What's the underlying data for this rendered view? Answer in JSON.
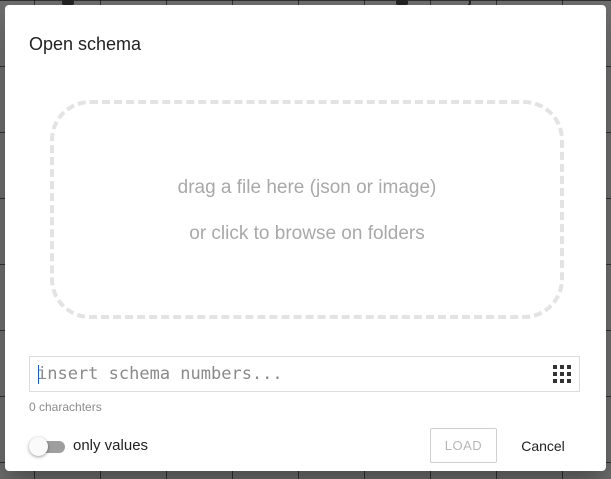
{
  "dialog": {
    "title": "Open schema"
  },
  "dropzone": {
    "line1": "drag a file here (json or image)",
    "line2": "or click to browse on folders"
  },
  "schema_input": {
    "value": "",
    "placeholder": "insert schema numbers...",
    "keypad_icon": "keypad-grid-icon"
  },
  "char_count": "0 charachters",
  "only_values_toggle": {
    "label": "only values",
    "checked": false
  },
  "actions": {
    "load_label": "LOAD",
    "load_disabled": true,
    "cancel_label": "Cancel"
  },
  "colors": {
    "backdrop": "#6b6b6b",
    "dialog_bg": "#ffffff",
    "dropzone_border": "#e3e3e3",
    "muted_text": "#a9a9a9",
    "caret": "#1a56c8"
  }
}
